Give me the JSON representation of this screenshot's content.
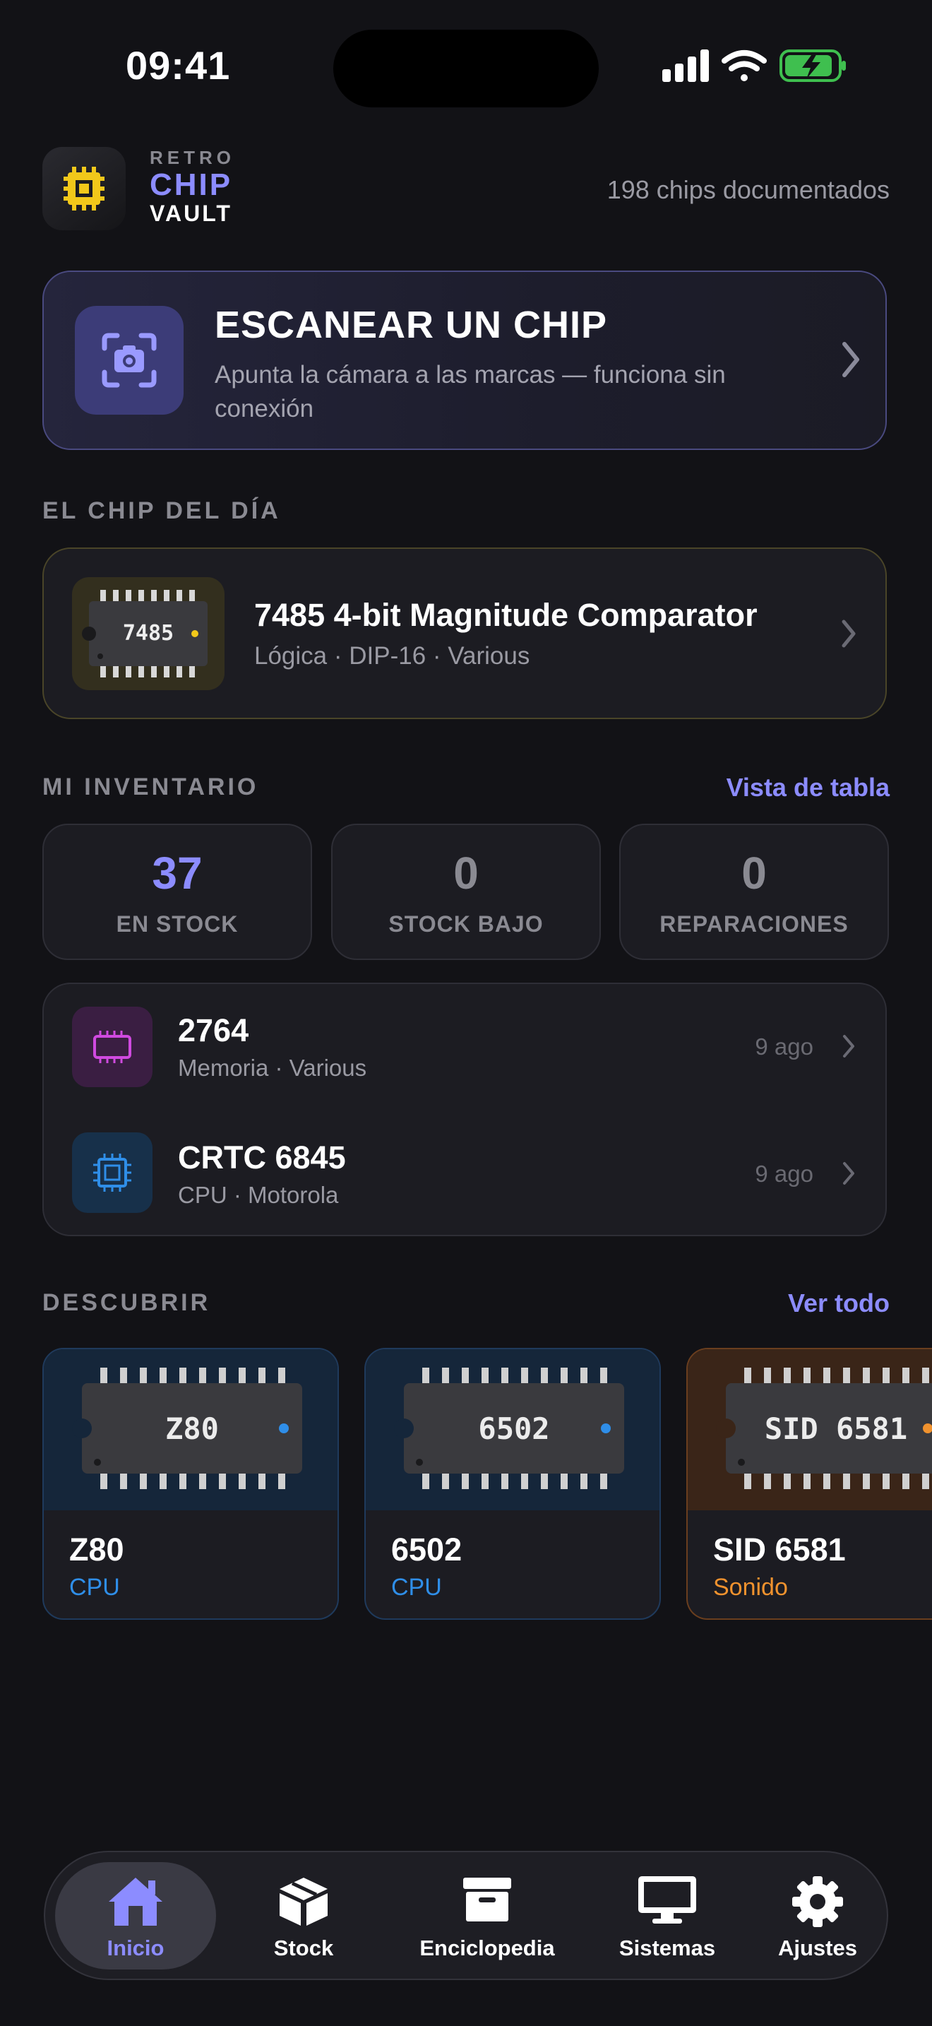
{
  "status_bar": {
    "time": "09:41"
  },
  "header": {
    "logo_retro": "RETRO",
    "logo_chip": "CHIP",
    "logo_vault": "VAULT",
    "chip_count": "198 chips documentados"
  },
  "scan": {
    "title": "ESCANEAR UN CHIP",
    "subtitle": "Apunta la cámara a las marcas — funciona sin conexión"
  },
  "chip_of_day": {
    "section_label": "EL CHIP DEL DÍA",
    "chip_marking": "7485",
    "title": "7485 4-bit Magnitude Comparator",
    "subtitle": "Lógica · DIP-16 · Various"
  },
  "inventory": {
    "section_label": "MI INVENTARIO",
    "table_view_link": "Vista de tabla",
    "stats": [
      {
        "value": "37",
        "label": "EN STOCK",
        "color": "#8c8cff"
      },
      {
        "value": "0",
        "label": "STOCK BAJO",
        "color": "#8a8a92"
      },
      {
        "value": "0",
        "label": "REPARACIONES",
        "color": "#8a8a92"
      }
    ],
    "items": [
      {
        "name": "2764",
        "subtitle": "Memoria · Various",
        "ago": "9 ago",
        "icon": "memory-chip-icon",
        "color": "#d04ae0"
      },
      {
        "name": "CRTC 6845",
        "subtitle": "CPU · Motorola",
        "ago": "9 ago",
        "icon": "cpu-chip-icon",
        "color": "#2f8ee8"
      }
    ]
  },
  "discover": {
    "section_label": "DESCUBRIR",
    "see_all_link": "Ver todo",
    "cards": [
      {
        "marking": "Z80",
        "name": "Z80",
        "category": "CPU",
        "color": "#2f8ee8"
      },
      {
        "marking": "6502",
        "name": "6502",
        "category": "CPU",
        "color": "#2f8ee8"
      },
      {
        "marking": "SID 6581",
        "name": "SID 6581",
        "category": "Sonido",
        "color": "#f0922e"
      }
    ]
  },
  "tabs": [
    {
      "label": "Inicio",
      "icon": "home-icon",
      "active": true
    },
    {
      "label": "Stock",
      "icon": "box-icon",
      "active": false
    },
    {
      "label": "Enciclopedia",
      "icon": "archive-icon",
      "active": false
    },
    {
      "label": "Sistemas",
      "icon": "monitor-icon",
      "active": false
    },
    {
      "label": "Ajustes",
      "icon": "gear-icon",
      "active": false
    }
  ]
}
